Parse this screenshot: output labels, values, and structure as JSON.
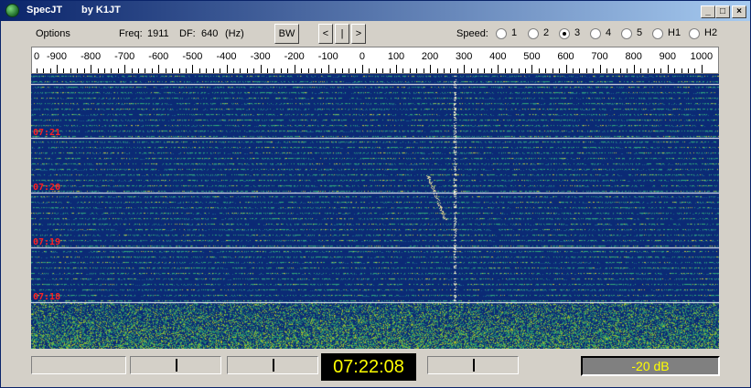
{
  "window": {
    "title": "SpecJT",
    "author": "by K1JT",
    "min_label": "_",
    "max_label": "□",
    "close_label": "×"
  },
  "menu": {
    "options_label": "Options",
    "freq_label": "Freq:",
    "freq_value": "1911",
    "df_label": "DF:",
    "df_value": "640",
    "df_unit": "(Hz)",
    "bw_label": "BW",
    "nav_left": "<",
    "nav_center": "|",
    "nav_right": ">"
  },
  "speed": {
    "label": "Speed:",
    "options": [
      "1",
      "2",
      "3",
      "4",
      "5",
      "H1",
      "H2"
    ],
    "selected": "3"
  },
  "scale": {
    "ticks": [
      "-900",
      "-800",
      "-700",
      "-600",
      "-500",
      "-400",
      "-300",
      "-200",
      "-100",
      "0",
      "100",
      "200",
      "300",
      "400",
      "500",
      "600",
      "700",
      "800",
      "900",
      "1000"
    ],
    "start_label": "0"
  },
  "waterfall": {
    "time_labels": [
      "07:21",
      "07:20",
      "07:19",
      "07:18"
    ],
    "background": "#0b2a75",
    "label_color": "#ff2020"
  },
  "status": {
    "clock": "07:22:08",
    "level": "-20 dB",
    "level_color": "#ffff00"
  }
}
